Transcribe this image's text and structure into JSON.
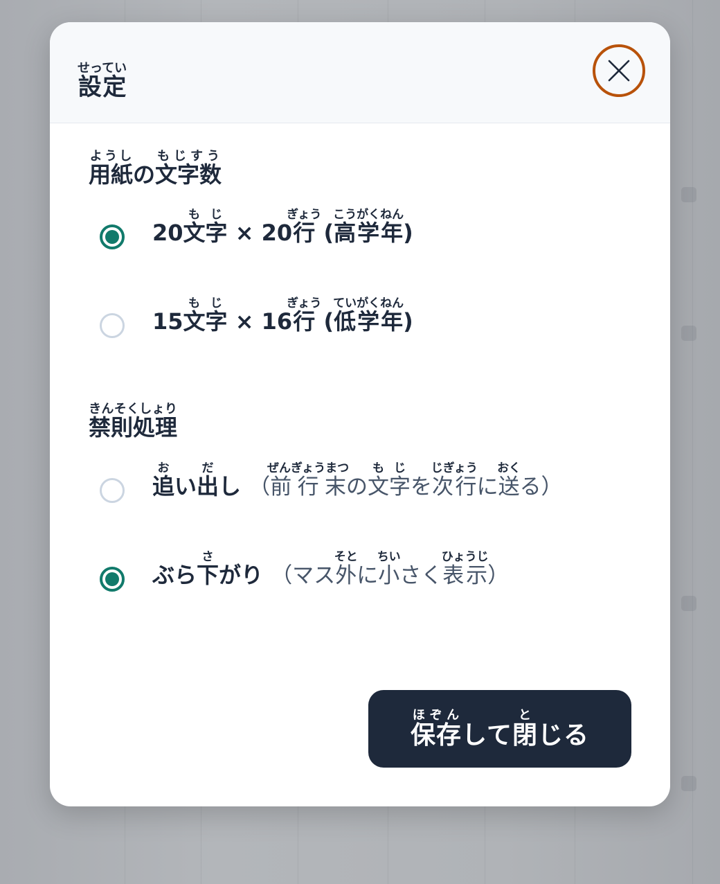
{
  "modal": {
    "title": {
      "text": "設定",
      "ruby": "せってい"
    },
    "close_icon": "close-icon"
  },
  "paper_size": {
    "heading": [
      {
        "text": "用紙",
        "ruby": "ようし"
      },
      {
        "text": "の",
        "ruby": ""
      },
      {
        "text": "文字数",
        "ruby": "もじすう"
      }
    ],
    "options": [
      {
        "checked": true,
        "label": [
          {
            "text": "20",
            "ruby": ""
          },
          {
            "text": "文字",
            "ruby": "もじ"
          },
          {
            "text": " × 20",
            "ruby": ""
          },
          {
            "text": "行",
            "ruby": "ぎょう"
          },
          {
            "text": " (",
            "ruby": ""
          },
          {
            "text": "高学年",
            "ruby": "こうがくねん"
          },
          {
            "text": ")",
            "ruby": ""
          }
        ]
      },
      {
        "checked": false,
        "label": [
          {
            "text": "15",
            "ruby": ""
          },
          {
            "text": "文字",
            "ruby": "もじ"
          },
          {
            "text": " × 16",
            "ruby": ""
          },
          {
            "text": "行",
            "ruby": "ぎょう"
          },
          {
            "text": " (",
            "ruby": ""
          },
          {
            "text": "低学年",
            "ruby": "ていがくねん"
          },
          {
            "text": ")",
            "ruby": ""
          }
        ]
      }
    ]
  },
  "kinsoku": {
    "heading": [
      {
        "text": "禁則処理",
        "ruby": "きんそくしょり"
      }
    ],
    "options": [
      {
        "checked": false,
        "label": [
          {
            "text": "追",
            "ruby": "お"
          },
          {
            "text": "い",
            "ruby": ""
          },
          {
            "text": "出",
            "ruby": "だ"
          },
          {
            "text": "し",
            "ruby": ""
          }
        ],
        "sub": [
          {
            "text": "（",
            "ruby": ""
          },
          {
            "text": "前行末",
            "ruby": "ぜんぎょうまつ"
          },
          {
            "text": "の",
            "ruby": ""
          },
          {
            "text": "文字",
            "ruby": "もじ"
          },
          {
            "text": "を",
            "ruby": ""
          },
          {
            "text": "次行",
            "ruby": "じぎょう"
          },
          {
            "text": "に",
            "ruby": ""
          },
          {
            "text": "送",
            "ruby": "おく"
          },
          {
            "text": "る）",
            "ruby": ""
          }
        ]
      },
      {
        "checked": true,
        "label": [
          {
            "text": "ぶら",
            "ruby": ""
          },
          {
            "text": "下",
            "ruby": "さ"
          },
          {
            "text": "がり",
            "ruby": ""
          }
        ],
        "sub": [
          {
            "text": "（マス",
            "ruby": ""
          },
          {
            "text": "外",
            "ruby": "そと"
          },
          {
            "text": "に",
            "ruby": ""
          },
          {
            "text": "小",
            "ruby": "ちい"
          },
          {
            "text": "さく",
            "ruby": ""
          },
          {
            "text": "表示",
            "ruby": "ひょうじ"
          },
          {
            "text": "）",
            "ruby": ""
          }
        ]
      }
    ]
  },
  "save_button": {
    "label": [
      {
        "text": "保存",
        "ruby": "ほぞん"
      },
      {
        "text": "して",
        "ruby": ""
      },
      {
        "text": "閉",
        "ruby": "と"
      },
      {
        "text": "じる",
        "ruby": ""
      }
    ]
  },
  "colors": {
    "accent": "#117a6b",
    "close_ring": "#b8520a",
    "primary_button": "#1e293b",
    "text": "#1e293b"
  }
}
